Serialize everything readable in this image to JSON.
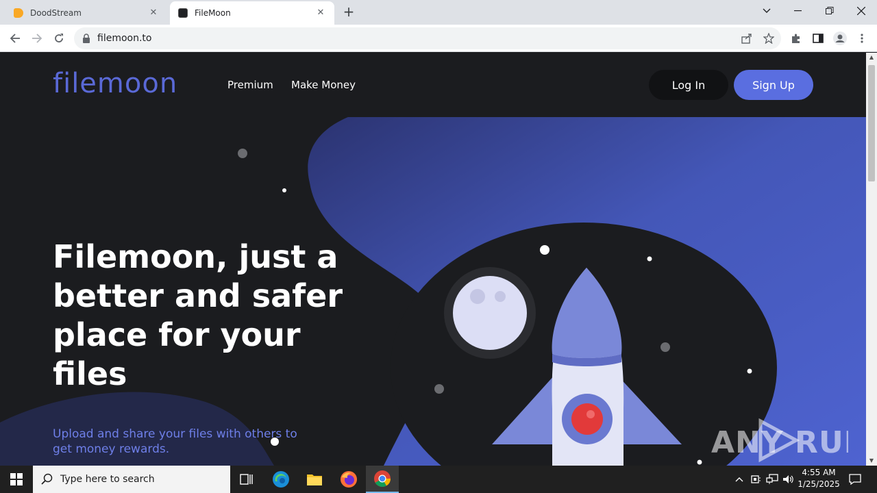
{
  "browser": {
    "tabs": [
      {
        "label": "DoodStream",
        "icon": "doodstream-favicon",
        "color": "#f9a825"
      },
      {
        "label": "FileMoon",
        "icon": "filemoon-favicon",
        "color": "#202124"
      }
    ],
    "url": "filemoon.to"
  },
  "site": {
    "logo_text": "filemoon",
    "nav": {
      "premium": "Premium",
      "make_money": "Make Money"
    },
    "login": "Log In",
    "signup": "Sign Up",
    "headline": "Filemoon, just a better and safer place for your files",
    "subline": "Upload and share your files with others to get money rewards.",
    "accent": "#5a6ee0"
  },
  "watermark": "ANY RUN",
  "taskbar": {
    "search_placeholder": "Type here to search",
    "time": "4:55 AM",
    "date": "1/25/2025"
  }
}
